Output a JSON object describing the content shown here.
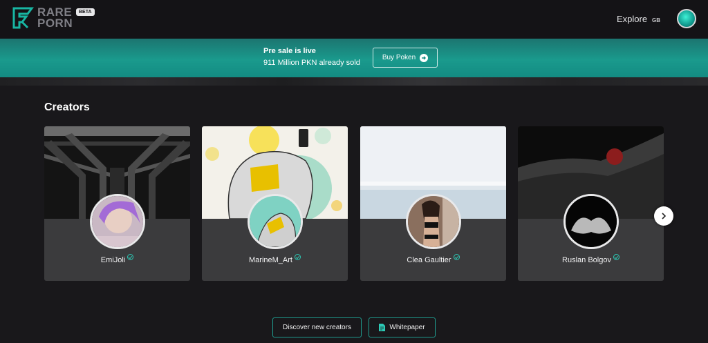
{
  "header": {
    "logo_line1": "RARE",
    "logo_line2": "PORN",
    "badge": "BETA",
    "explore": "Explore",
    "lang": "GB"
  },
  "banner": {
    "title": "Pre sale is live",
    "subtitle": "911 Million PKN already sold",
    "button": "Buy Poken"
  },
  "section": {
    "title": "Creators"
  },
  "creators": [
    {
      "name": "EmiJoli",
      "verified": true
    },
    {
      "name": "MarineM_Art",
      "verified": true
    },
    {
      "name": "Clea Gaultier",
      "verified": true
    },
    {
      "name": "Ruslan Bolgov",
      "verified": true
    }
  ],
  "footer": {
    "discover": "Discover new creators",
    "whitepaper": "Whitepaper"
  },
  "icons": {
    "logo": "logo-mark-icon",
    "arrow": "arrow-right-circle-icon",
    "verified": "verified-check-icon",
    "next": "chevron-right-icon",
    "document": "document-icon"
  },
  "colors": {
    "accent": "#1a9a8d",
    "background": "#19181b",
    "card": "#3b3b3d"
  }
}
